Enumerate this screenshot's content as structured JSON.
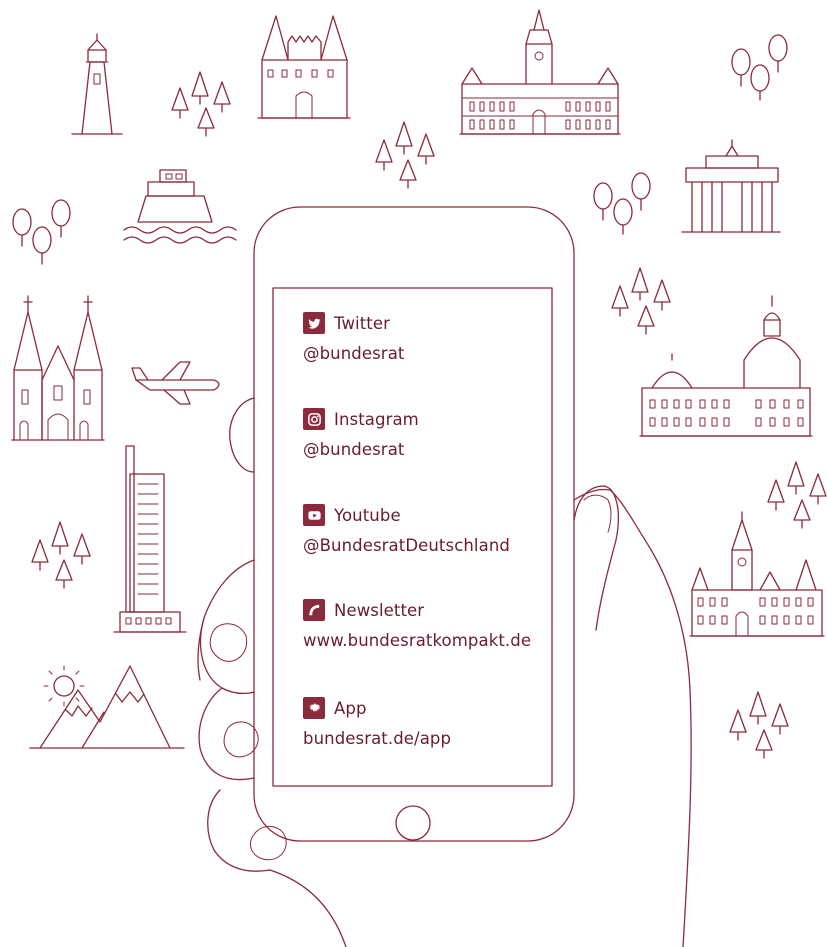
{
  "accent_color": "#8a2a3c",
  "links": [
    {
      "icon": "twitter-icon",
      "label": "Twitter",
      "handle": "@bundesrat"
    },
    {
      "icon": "instagram-icon",
      "label": "Instagram",
      "handle": "@bundesrat"
    },
    {
      "icon": "youtube-icon",
      "label": "Youtube",
      "handle": "@BundesratDeutschland"
    },
    {
      "icon": "newsletter-icon",
      "label": "Newsletter",
      "handle": "www.bundesratkompakt.de"
    },
    {
      "icon": "eagle-icon",
      "label": "App",
      "handle": "bundesrat.de/app"
    }
  ]
}
